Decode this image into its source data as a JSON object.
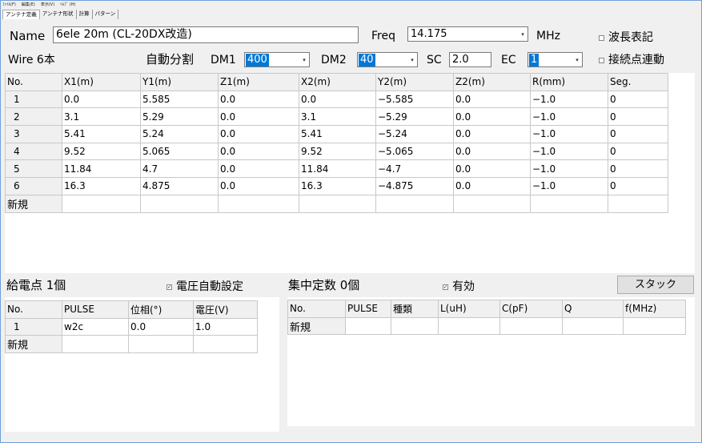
{
  "menu": [
    "ﾌｧｲﾙ(F)",
    "編集(E)",
    "表示(V)",
    "ﾍﾙﾌﾟ (H)"
  ],
  "tabs": [
    "アンテナ定義",
    "アンテナ形状",
    "計算",
    "パターン"
  ],
  "header": {
    "name_label": "Name",
    "name_value": "6ele 20m (CL-20DX改造)",
    "freq_label": "Freq",
    "freq_value": "14.175",
    "freq_unit": "MHz",
    "wavelength_label": "波長表記",
    "wire_count_label": "Wire 6本",
    "auto_split_label": "自動分割",
    "dm1_label": "DM1",
    "dm1_value": "400",
    "dm2_label": "DM2",
    "dm2_value": "40",
    "sc_label": "SC",
    "sc_value": "2.0",
    "ec_label": "EC",
    "ec_value": "1",
    "junction_link_label": "接続点連動"
  },
  "wire_table": {
    "headers": [
      "No.",
      "X1(m)",
      "Y1(m)",
      "Z1(m)",
      "X2(m)",
      "Y2(m)",
      "Z2(m)",
      "R(mm)",
      "Seg."
    ],
    "rows": [
      [
        "1",
        "0.0",
        "5.585",
        "0.0",
        "0.0",
        "−5.585",
        "0.0",
        "−1.0",
        "0"
      ],
      [
        "2",
        "3.1",
        "5.29",
        "0.0",
        "3.1",
        "−5.29",
        "0.0",
        "−1.0",
        "0"
      ],
      [
        "3",
        "5.41",
        "5.24",
        "0.0",
        "5.41",
        "−5.24",
        "0.0",
        "−1.0",
        "0"
      ],
      [
        "4",
        "9.52",
        "5.065",
        "0.0",
        "9.52",
        "−5.065",
        "0.0",
        "−1.0",
        "0"
      ],
      [
        "5",
        "11.84",
        "4.7",
        "0.0",
        "11.84",
        "−4.7",
        "0.0",
        "−1.0",
        "0"
      ],
      [
        "6",
        "16.3",
        "4.875",
        "0.0",
        "16.3",
        "−4.875",
        "0.0",
        "−1.0",
        "0"
      ]
    ],
    "new_row_label": "新規"
  },
  "feed": {
    "title": "給電点 1個",
    "auto_voltage_label": "電圧自動設定",
    "headers": [
      "No.",
      "PULSE",
      "位相(°)",
      "電圧(V)"
    ],
    "rows": [
      [
        "1",
        "w2c",
        "0.0",
        "1.0"
      ]
    ],
    "new_row_label": "新規"
  },
  "lumped": {
    "title": "集中定数 0個",
    "enabled_label": "有効",
    "stack_button": "スタック",
    "headers": [
      "No.",
      "PULSE",
      "種類",
      "L(uH)",
      "C(pF)",
      "Q",
      "f(MHz)"
    ],
    "new_row_label": "新規"
  }
}
